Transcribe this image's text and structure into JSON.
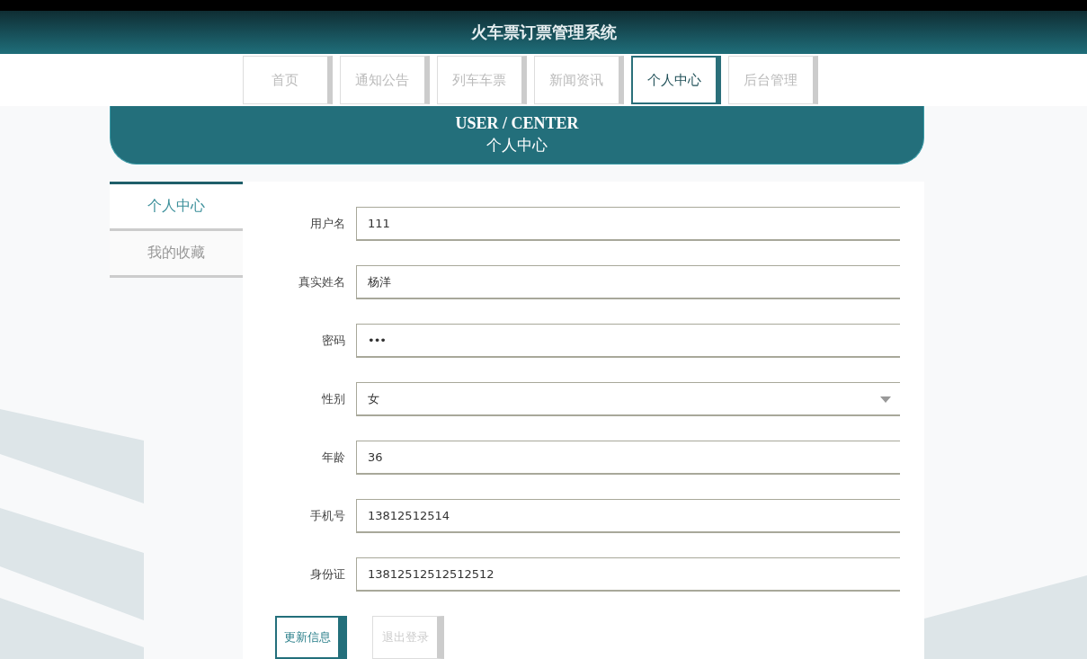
{
  "header": {
    "title": "火车票订票管理系统"
  },
  "nav": [
    {
      "label": "首页",
      "selected": false
    },
    {
      "label": "通知公告",
      "selected": false
    },
    {
      "label": "列车车票",
      "selected": false
    },
    {
      "label": "新闻资讯",
      "selected": false
    },
    {
      "label": "个人中心",
      "selected": true
    },
    {
      "label": "后台管理",
      "selected": false
    }
  ],
  "banner": {
    "title": "USER / CENTER",
    "subtitle": "个人中心"
  },
  "sidebar": [
    {
      "label": "个人中心",
      "selected": true
    },
    {
      "label": "我的收藏",
      "selected": false
    }
  ],
  "form": [
    {
      "label": "用户名",
      "kind": "text",
      "value": "111"
    },
    {
      "label": "真实姓名",
      "kind": "text",
      "value": "杨洋"
    },
    {
      "label": "密码",
      "kind": "password",
      "value": "•••"
    },
    {
      "label": "性别",
      "kind": "select",
      "value": "女"
    },
    {
      "label": "年龄",
      "kind": "text",
      "value": "36"
    },
    {
      "label": "手机号",
      "kind": "text",
      "value": "13812512514"
    },
    {
      "label": "身份证",
      "kind": "text",
      "value": "13812512512512512"
    }
  ],
  "buttons": [
    {
      "label": "更新信息",
      "kind": "primary"
    },
    {
      "label": "退出登录",
      "kind": "secondary"
    }
  ]
}
